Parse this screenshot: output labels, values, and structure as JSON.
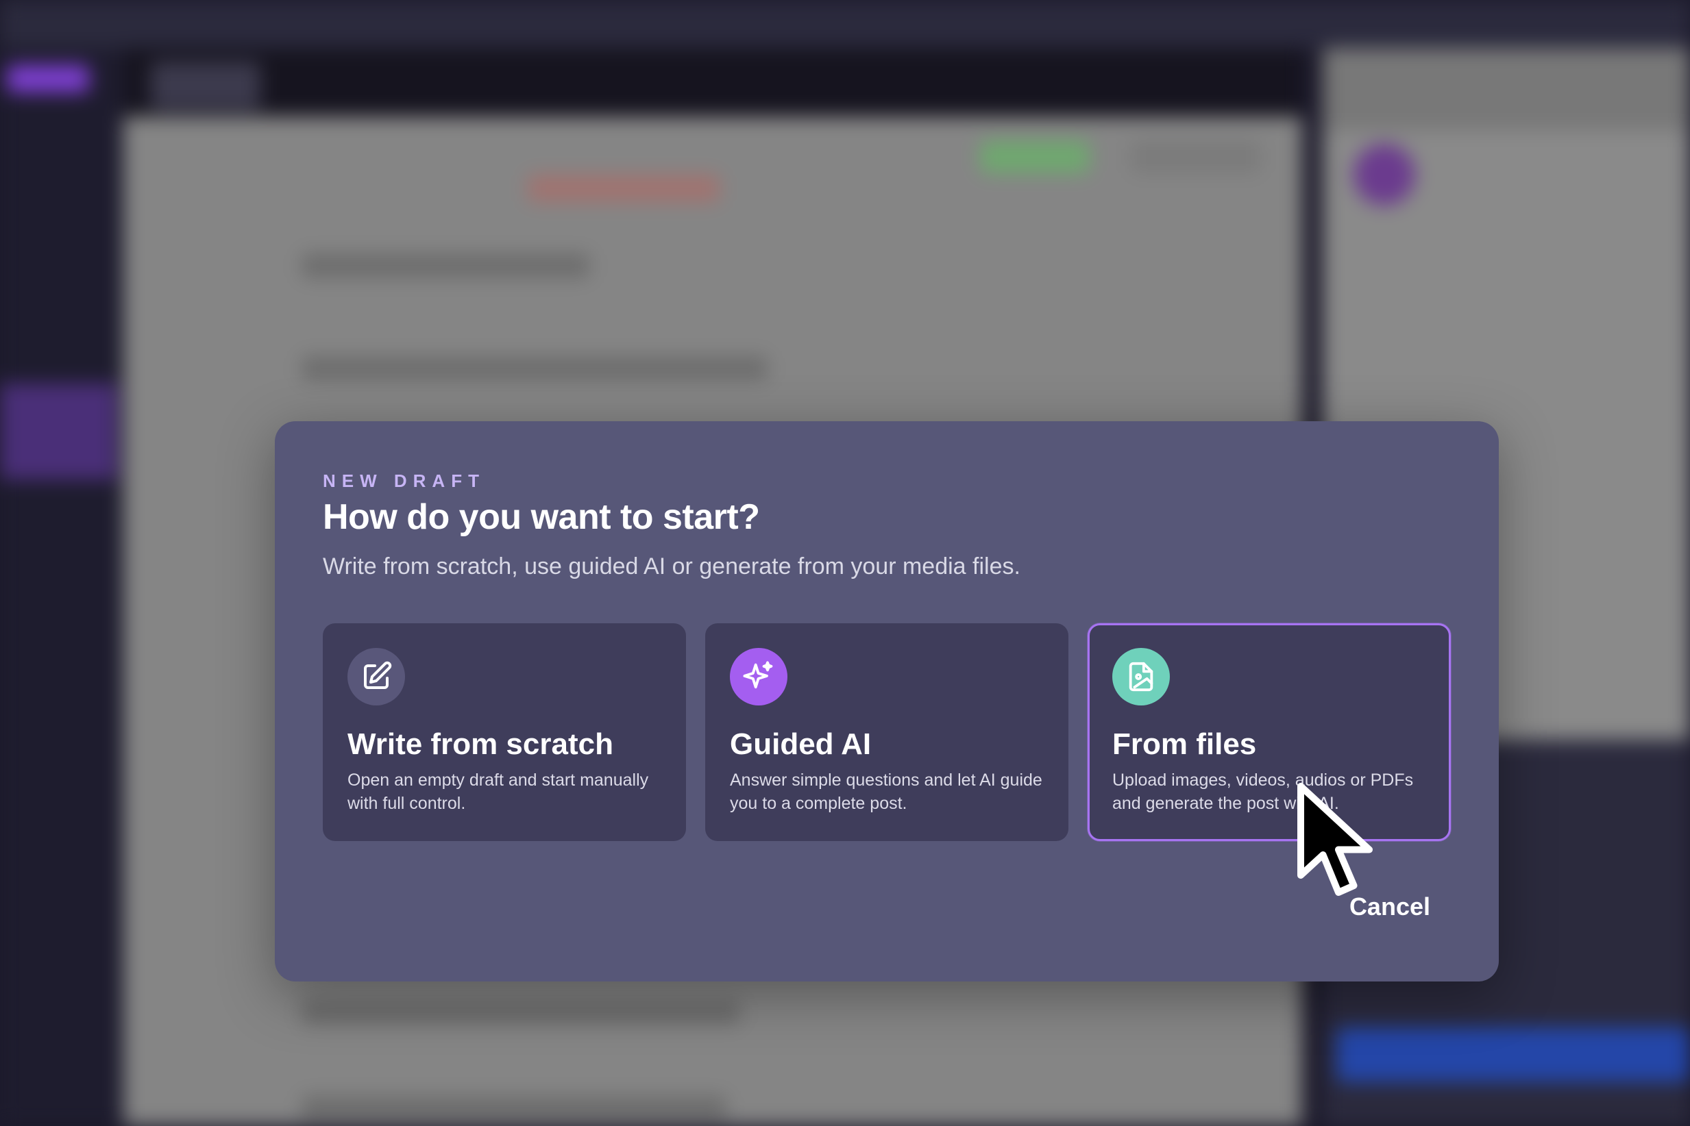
{
  "modal": {
    "eyebrow": "NEW DRAFT",
    "title": "How do you want to start?",
    "subtitle": "Write from scratch, use guided AI or generate from your media files.",
    "cancel_label": "Cancel"
  },
  "options": [
    {
      "title": "Write from scratch",
      "description": "Open an empty draft and start manually with full control.",
      "icon": "edit-icon",
      "icon_color": "#59577a"
    },
    {
      "title": "Guided AI",
      "description": "Answer simple questions and let AI guide you to a complete post.",
      "icon": "sparkles-icon",
      "icon_color": "#a45ef0"
    },
    {
      "title": "From files",
      "description": "Upload images, videos, audios or PDFs and generate the post with AI.",
      "icon": "file-image-icon",
      "icon_color": "#6fd1bb",
      "state": "hovered"
    }
  ],
  "colors": {
    "modal_bg": "#575778",
    "card_bg": "#3f3d5b",
    "accent": "#a774f2",
    "eyebrow": "#c7b5f5"
  }
}
